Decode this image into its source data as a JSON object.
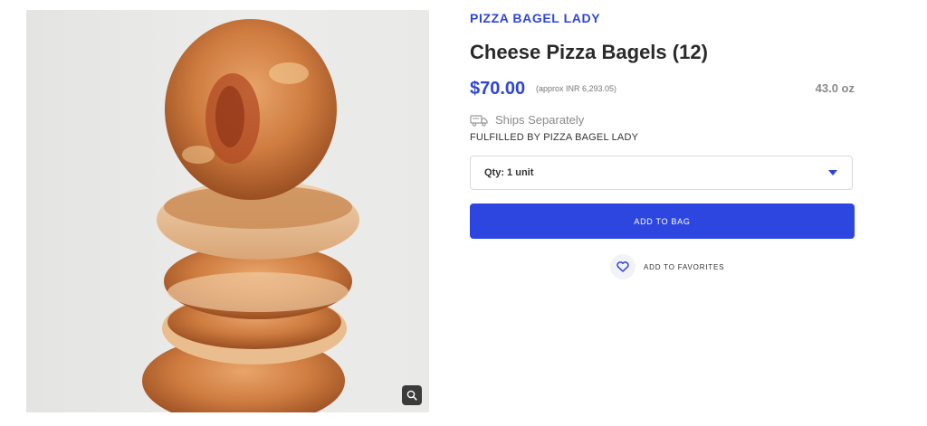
{
  "product": {
    "brand": "PIZZA BAGEL LADY",
    "title": "Cheese Pizza Bagels (12)",
    "price": "$70.00",
    "approx_price": "(approx INR 6,293.05)",
    "weight": "43.0 oz",
    "shipping": "Ships Separately",
    "fulfilled_by": "FULFILLED BY PIZZA BAGEL LADY"
  },
  "quantity": {
    "selected": "Qty: 1 unit"
  },
  "actions": {
    "add_to_bag": "ADD TO BAG",
    "add_to_favorites": "ADD TO FAVORITES"
  },
  "icons": {
    "zoom": "magnifier-icon",
    "shipping": "truck-icon",
    "dropdown": "caret-down-icon",
    "favorite": "heart-icon"
  },
  "colors": {
    "accent": "#2f45d9",
    "button": "#2e46e0",
    "muted": "#8a8a8a"
  }
}
